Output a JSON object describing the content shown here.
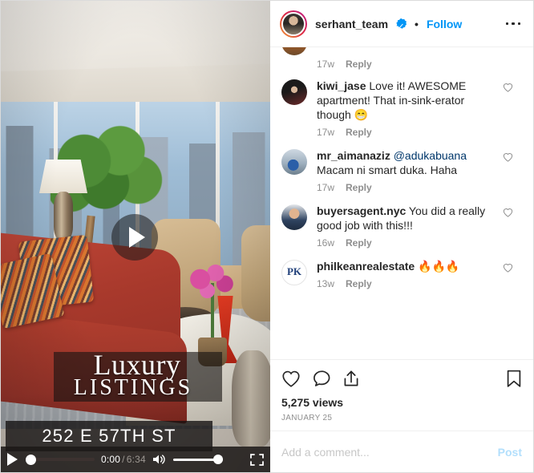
{
  "header": {
    "username": "serhant_team",
    "verified_badge": "verified-badge",
    "separator": "•",
    "follow_label": "Follow",
    "more_options": "more-options",
    "avatar": "profile-avatar"
  },
  "video": {
    "play_overlay": "play-button",
    "brand_line1": "Luxury",
    "brand_line2": "LISTINGS",
    "address": "252 E 57TH ST",
    "controls": {
      "play_label": "play",
      "current_time": "0:00",
      "separator": "/",
      "duration": "6:34",
      "volume_label": "volume",
      "fullscreen_label": "fullscreen",
      "progress_percent": 0,
      "volume_percent": 100
    }
  },
  "comments": {
    "truncated_top": {
      "time": "17w",
      "reply_label": "Reply"
    },
    "items": [
      {
        "username": "kiwi_jase",
        "text": " Love it! AWESOME apartment! That in-sink-erator though 😁",
        "mention": "",
        "time": "17w",
        "reply_label": "Reply",
        "avatar": "avatar-kiwi-jase"
      },
      {
        "username": "mr_aimanaziz",
        "mention": "@adukabuana",
        "text": " Macam ni smart duka. Haha",
        "time": "17w",
        "reply_label": "Reply",
        "avatar": "avatar-mr-aimanaziz"
      },
      {
        "username": "buyersagent.nyc",
        "mention": "",
        "text": " You did a really good job with this!!!",
        "time": "16w",
        "reply_label": "Reply",
        "avatar": "avatar-buyersagent-nyc"
      },
      {
        "username": "philkeanrealestate",
        "mention": "",
        "text": " 🔥🔥🔥",
        "time": "13w",
        "reply_label": "Reply",
        "avatar": "avatar-philkeanrealestate"
      }
    ]
  },
  "actions": {
    "like_label": "Like",
    "comment_label": "Comment",
    "share_label": "Share",
    "save_label": "Save"
  },
  "stats": {
    "views": "5,275 views",
    "date": "JANUARY 25"
  },
  "add_comment": {
    "placeholder": "Add a comment...",
    "value": "",
    "post_label": "Post"
  },
  "colors": {
    "accent_blue": "#0095f6",
    "mention_blue": "#00376b",
    "post_disabled": "#b2dffc",
    "text_primary": "#262626",
    "text_secondary": "#8e8e8e"
  }
}
